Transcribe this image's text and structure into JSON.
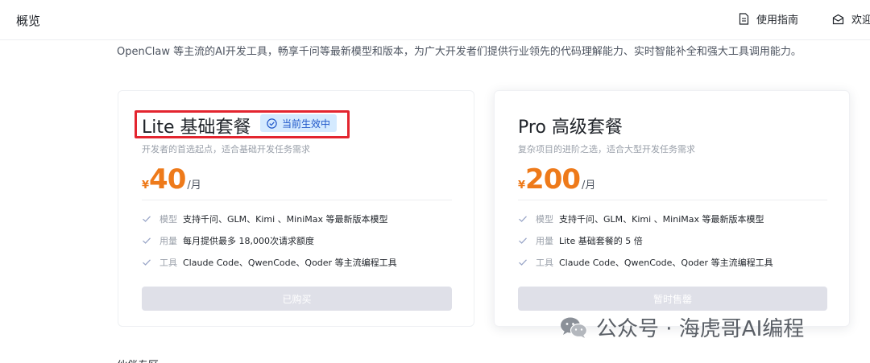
{
  "header": {
    "page_title": "概览",
    "links": [
      {
        "label": "使用指南",
        "icon": "document-icon"
      },
      {
        "label": "欢迎",
        "icon": "mail-icon"
      }
    ]
  },
  "intro_text": "OpenClaw 等主流的AI开发工具，畅享千问等最新模型和版本，为广大开发者们提供行业领先的代码理解能力、实时智能补全和强大工具调用能力。",
  "plans": [
    {
      "name": "Lite 基础套餐",
      "badge": "当前生效中",
      "description": "开发者的首选起点，适合基础开发任务需求",
      "currency": "¥",
      "price": "40",
      "unit": "/月",
      "features": [
        {
          "label": "模型",
          "text": "支持千问、GLM、Kimi 、MiniMax 等最新版本模型"
        },
        {
          "label": "用量",
          "text": "每月提供最多 18,000次请求额度"
        },
        {
          "label": "工具",
          "text": "Claude Code、QwenCode、Qoder 等主流编程工具"
        }
      ],
      "button_label": "已购买"
    },
    {
      "name": "Pro 高级套餐",
      "description": "复杂项目的进阶之选，适合大型开发任务需求",
      "currency": "¥",
      "price": "200",
      "unit": "/月",
      "features": [
        {
          "label": "模型",
          "text": "支持千问、GLM、Kimi 、MiniMax 等最新版本模型"
        },
        {
          "label": "用量",
          "text": "Lite 基础套餐的 5 倍"
        },
        {
          "label": "工具",
          "text": "Claude Code、QwenCode、Qoder 等主流编程工具"
        }
      ],
      "button_label": "暂时售罄"
    }
  ],
  "watermark": "公众号 · 海虎哥AI编程",
  "next_section_heading": "伙伴专区",
  "colors": {
    "price_accent": "#ee7a1a",
    "badge_bg": "#d4eaff",
    "badge_text": "#1f57c9",
    "highlight": "#e3252f",
    "check": "#9aa6c8",
    "button_disabled": "#dfe0e8"
  }
}
